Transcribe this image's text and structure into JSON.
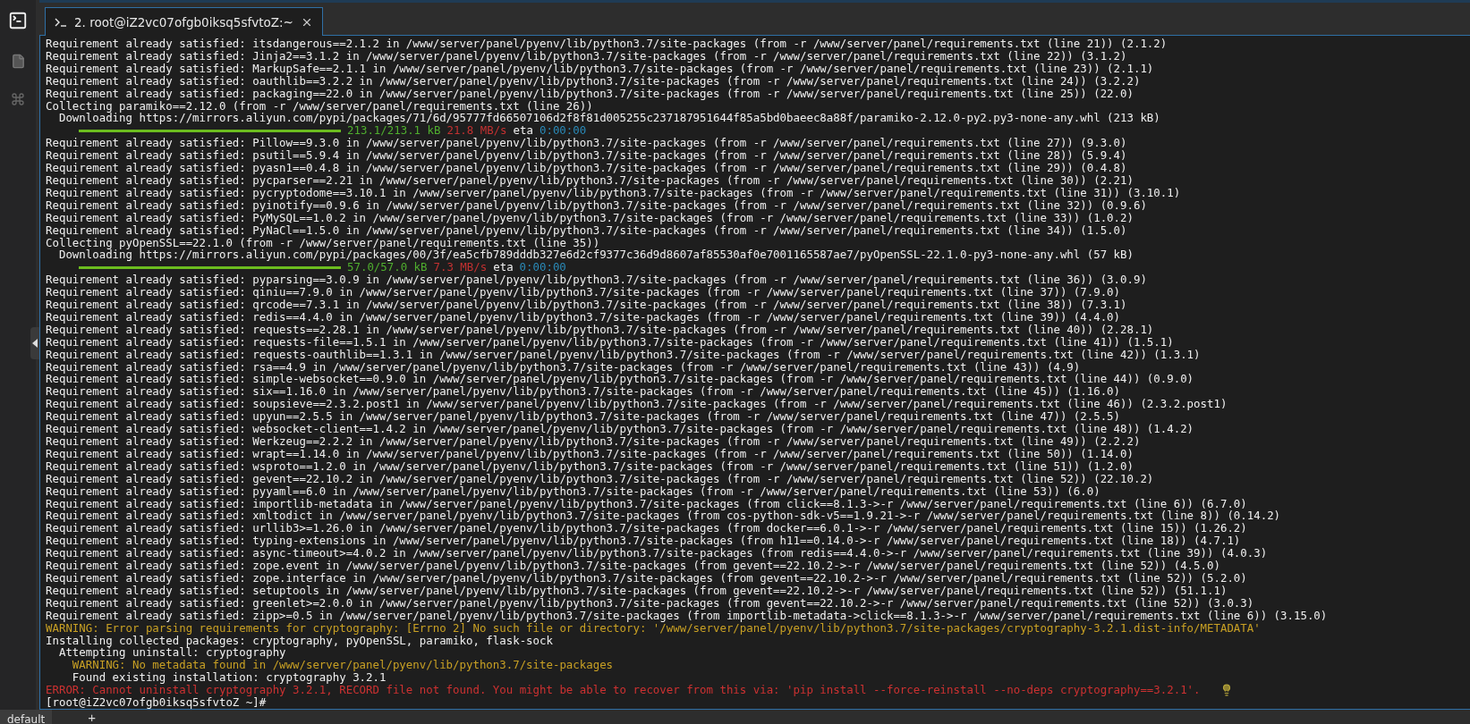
{
  "tabs": [
    {
      "title": "2. root@iZ2vc07ofgb0iksq5sfvtoZ:~",
      "selected": true
    }
  ],
  "terminal": {
    "lines": [
      {
        "kind": "normal",
        "text": "Requirement already satisfied: itsdangerous==2.1.2 in /www/server/panel/pyenv/lib/python3.7/site-packages (from -r /www/server/panel/requirements.txt (line 21)) (2.1.2)"
      },
      {
        "kind": "normal",
        "text": "Requirement already satisfied: Jinja2==3.1.2 in /www/server/panel/pyenv/lib/python3.7/site-packages (from -r /www/server/panel/requirements.txt (line 22)) (3.1.2)"
      },
      {
        "kind": "normal",
        "text": "Requirement already satisfied: MarkupSafe==2.1.1 in /www/server/panel/pyenv/lib/python3.7/site-packages (from -r /www/server/panel/requirements.txt (line 23)) (2.1.1)"
      },
      {
        "kind": "normal",
        "text": "Requirement already satisfied: oauthlib==3.2.2 in /www/server/panel/pyenv/lib/python3.7/site-packages (from -r /www/server/panel/requirements.txt (line 24)) (3.2.2)"
      },
      {
        "kind": "normal",
        "text": "Requirement already satisfied: packaging==22.0 in /www/server/panel/pyenv/lib/python3.7/site-packages (from -r /www/server/panel/requirements.txt (line 25)) (22.0)"
      },
      {
        "kind": "normal",
        "text": "Collecting paramiko==2.12.0 (from -r /www/server/panel/requirements.txt (line 26))"
      },
      {
        "kind": "normal",
        "text": "  Downloading https://mirrors.aliyun.com/pypi/packages/71/6d/95777fd66507106d2f8f81d005255c237187951644f85a5bd0baeec8a88f/paramiko-2.12.0-py2.py3-none-any.whl (213 kB)"
      },
      {
        "kind": "progress",
        "level": 1,
        "done": "213.1/213.1 kB",
        "speed": "21.8 MB/s",
        "eta_label": "eta",
        "eta": "0:00:00"
      },
      {
        "kind": "normal",
        "text": "Requirement already satisfied: Pillow==9.3.0 in /www/server/panel/pyenv/lib/python3.7/site-packages (from -r /www/server/panel/requirements.txt (line 27)) (9.3.0)"
      },
      {
        "kind": "normal",
        "text": "Requirement already satisfied: psutil==5.9.4 in /www/server/panel/pyenv/lib/python3.7/site-packages (from -r /www/server/panel/requirements.txt (line 28)) (5.9.4)"
      },
      {
        "kind": "normal",
        "text": "Requirement already satisfied: pyasn1==0.4.8 in /www/server/panel/pyenv/lib/python3.7/site-packages (from -r /www/server/panel/requirements.txt (line 29)) (0.4.8)"
      },
      {
        "kind": "normal",
        "text": "Requirement already satisfied: pycparser==2.21 in /www/server/panel/pyenv/lib/python3.7/site-packages (from -r /www/server/panel/requirements.txt (line 30)) (2.21)"
      },
      {
        "kind": "normal",
        "text": "Requirement already satisfied: pycryptodome==3.10.1 in /www/server/panel/pyenv/lib/python3.7/site-packages (from -r /www/server/panel/requirements.txt (line 31)) (3.10.1)"
      },
      {
        "kind": "normal",
        "text": "Requirement already satisfied: pyinotify==0.9.6 in /www/server/panel/pyenv/lib/python3.7/site-packages (from -r /www/server/panel/requirements.txt (line 32)) (0.9.6)"
      },
      {
        "kind": "normal",
        "text": "Requirement already satisfied: PyMySQL==1.0.2 in /www/server/panel/pyenv/lib/python3.7/site-packages (from -r /www/server/panel/requirements.txt (line 33)) (1.0.2)"
      },
      {
        "kind": "normal",
        "text": "Requirement already satisfied: PyNaCl==1.5.0 in /www/server/panel/pyenv/lib/python3.7/site-packages (from -r /www/server/panel/requirements.txt (line 34)) (1.5.0)"
      },
      {
        "kind": "normal",
        "text": "Collecting pyOpenSSL==22.1.0 (from -r /www/server/panel/requirements.txt (line 35))"
      },
      {
        "kind": "normal",
        "text": "  Downloading https://mirrors.aliyun.com/pypi/packages/00/3f/ea5cfb789dddb327e6d2cf9377c36d9d8607af85530af0e7001165587ae7/pyOpenSSL-22.1.0-py3-none-any.whl (57 kB)"
      },
      {
        "kind": "progress",
        "level": 1,
        "done": "57.0/57.0 kB",
        "speed": "7.3 MB/s",
        "eta_label": "eta",
        "eta": "0:00:00"
      },
      {
        "kind": "normal",
        "text": "Requirement already satisfied: pyparsing==3.0.9 in /www/server/panel/pyenv/lib/python3.7/site-packages (from -r /www/server/panel/requirements.txt (line 36)) (3.0.9)"
      },
      {
        "kind": "normal",
        "text": "Requirement already satisfied: qiniu==7.9.0 in /www/server/panel/pyenv/lib/python3.7/site-packages (from -r /www/server/panel/requirements.txt (line 37)) (7.9.0)"
      },
      {
        "kind": "normal",
        "text": "Requirement already satisfied: qrcode==7.3.1 in /www/server/panel/pyenv/lib/python3.7/site-packages (from -r /www/server/panel/requirements.txt (line 38)) (7.3.1)"
      },
      {
        "kind": "normal",
        "text": "Requirement already satisfied: redis==4.4.0 in /www/server/panel/pyenv/lib/python3.7/site-packages (from -r /www/server/panel/requirements.txt (line 39)) (4.4.0)"
      },
      {
        "kind": "normal",
        "text": "Requirement already satisfied: requests==2.28.1 in /www/server/panel/pyenv/lib/python3.7/site-packages (from -r /www/server/panel/requirements.txt (line 40)) (2.28.1)"
      },
      {
        "kind": "normal",
        "text": "Requirement already satisfied: requests-file==1.5.1 in /www/server/panel/pyenv/lib/python3.7/site-packages (from -r /www/server/panel/requirements.txt (line 41)) (1.5.1)"
      },
      {
        "kind": "normal",
        "text": "Requirement already satisfied: requests-oauthlib==1.3.1 in /www/server/panel/pyenv/lib/python3.7/site-packages (from -r /www/server/panel/requirements.txt (line 42)) (1.3.1)"
      },
      {
        "kind": "normal",
        "text": "Requirement already satisfied: rsa==4.9 in /www/server/panel/pyenv/lib/python3.7/site-packages (from -r /www/server/panel/requirements.txt (line 43)) (4.9)"
      },
      {
        "kind": "normal",
        "text": "Requirement already satisfied: simple-websocket==0.9.0 in /www/server/panel/pyenv/lib/python3.7/site-packages (from -r /www/server/panel/requirements.txt (line 44)) (0.9.0)"
      },
      {
        "kind": "normal",
        "text": "Requirement already satisfied: six==1.16.0 in /www/server/panel/pyenv/lib/python3.7/site-packages (from -r /www/server/panel/requirements.txt (line 45)) (1.16.0)"
      },
      {
        "kind": "normal",
        "text": "Requirement already satisfied: soupsieve==2.3.2.post1 in /www/server/panel/pyenv/lib/python3.7/site-packages (from -r /www/server/panel/requirements.txt (line 46)) (2.3.2.post1)"
      },
      {
        "kind": "normal",
        "text": "Requirement already satisfied: upyun==2.5.5 in /www/server/panel/pyenv/lib/python3.7/site-packages (from -r /www/server/panel/requirements.txt (line 47)) (2.5.5)"
      },
      {
        "kind": "normal",
        "text": "Requirement already satisfied: websocket-client==1.4.2 in /www/server/panel/pyenv/lib/python3.7/site-packages (from -r /www/server/panel/requirements.txt (line 48)) (1.4.2)"
      },
      {
        "kind": "normal",
        "text": "Requirement already satisfied: Werkzeug==2.2.2 in /www/server/panel/pyenv/lib/python3.7/site-packages (from -r /www/server/panel/requirements.txt (line 49)) (2.2.2)"
      },
      {
        "kind": "normal",
        "text": "Requirement already satisfied: wrapt==1.14.0 in /www/server/panel/pyenv/lib/python3.7/site-packages (from -r /www/server/panel/requirements.txt (line 50)) (1.14.0)"
      },
      {
        "kind": "normal",
        "text": "Requirement already satisfied: wsproto==1.2.0 in /www/server/panel/pyenv/lib/python3.7/site-packages (from -r /www/server/panel/requirements.txt (line 51)) (1.2.0)"
      },
      {
        "kind": "normal",
        "text": "Requirement already satisfied: gevent==22.10.2 in /www/server/panel/pyenv/lib/python3.7/site-packages (from -r /www/server/panel/requirements.txt (line 52)) (22.10.2)"
      },
      {
        "kind": "normal",
        "text": "Requirement already satisfied: pyyaml==6.0 in /www/server/panel/pyenv/lib/python3.7/site-packages (from -r /www/server/panel/requirements.txt (line 53)) (6.0)"
      },
      {
        "kind": "normal",
        "text": "Requirement already satisfied: importlib-metadata in /www/server/panel/pyenv/lib/python3.7/site-packages (from click==8.1.3->-r /www/server/panel/requirements.txt (line 6)) (6.7.0)"
      },
      {
        "kind": "normal",
        "text": "Requirement already satisfied: xmltodict in /www/server/panel/pyenv/lib/python3.7/site-packages (from cos-python-sdk-v5==1.9.21->-r /www/server/panel/requirements.txt (line 8)) (0.14.2)"
      },
      {
        "kind": "normal",
        "text": "Requirement already satisfied: urllib3>=1.26.0 in /www/server/panel/pyenv/lib/python3.7/site-packages (from docker==6.0.1->-r /www/server/panel/requirements.txt (line 15)) (1.26.2)"
      },
      {
        "kind": "normal",
        "text": "Requirement already satisfied: typing-extensions in /www/server/panel/pyenv/lib/python3.7/site-packages (from h11==0.14.0->-r /www/server/panel/requirements.txt (line 18)) (4.7.1)"
      },
      {
        "kind": "normal",
        "text": "Requirement already satisfied: async-timeout>=4.0.2 in /www/server/panel/pyenv/lib/python3.7/site-packages (from redis==4.4.0->-r /www/server/panel/requirements.txt (line 39)) (4.0.3)"
      },
      {
        "kind": "normal",
        "text": "Requirement already satisfied: zope.event in /www/server/panel/pyenv/lib/python3.7/site-packages (from gevent==22.10.2->-r /www/server/panel/requirements.txt (line 52)) (4.5.0)"
      },
      {
        "kind": "normal",
        "text": "Requirement already satisfied: zope.interface in /www/server/panel/pyenv/lib/python3.7/site-packages (from gevent==22.10.2->-r /www/server/panel/requirements.txt (line 52)) (5.2.0)"
      },
      {
        "kind": "normal",
        "text": "Requirement already satisfied: setuptools in /www/server/panel/pyenv/lib/python3.7/site-packages (from gevent==22.10.2->-r /www/server/panel/requirements.txt (line 52)) (51.1.1)"
      },
      {
        "kind": "normal",
        "text": "Requirement already satisfied: greenlet>=2.0.0 in /www/server/panel/pyenv/lib/python3.7/site-packages (from gevent==22.10.2->-r /www/server/panel/requirements.txt (line 52)) (3.0.3)"
      },
      {
        "kind": "normal",
        "text": "Requirement already satisfied: zipp>=0.5 in /www/server/panel/pyenv/lib/python3.7/site-packages (from importlib-metadata->click==8.1.3->-r /www/server/panel/requirements.txt (line 6)) (3.15.0)"
      },
      {
        "kind": "warning",
        "text": "WARNING: Error parsing requirements for cryptography: [Errno 2] No such file or directory: '/www/server/panel/pyenv/lib/python3.7/site-packages/cryptography-3.2.1.dist-info/METADATA'"
      },
      {
        "kind": "normal",
        "text": "Installing collected packages: cryptography, pyOpenSSL, paramiko, flask-sock"
      },
      {
        "kind": "normal",
        "text": "  Attempting uninstall: cryptography"
      },
      {
        "kind": "warning",
        "text": "    WARNING: No metadata found in /www/server/panel/pyenv/lib/python3.7/site-packages"
      },
      {
        "kind": "normal",
        "text": "    Found existing installation: cryptography 3.2.1"
      },
      {
        "kind": "error",
        "text": "ERROR: Cannot uninstall cryptography 3.2.1, RECORD file not found. You might be able to recover from this via: 'pip install --force-reinstall --no-deps cryptography==3.2.1'."
      },
      {
        "kind": "prompt",
        "text": "[root@iZ2vc07ofgb0iksq5sfvtoZ ~]#"
      }
    ]
  },
  "bottom_tabs": [
    {
      "label": "default",
      "selected": true
    }
  ],
  "add_tab": "+"
}
